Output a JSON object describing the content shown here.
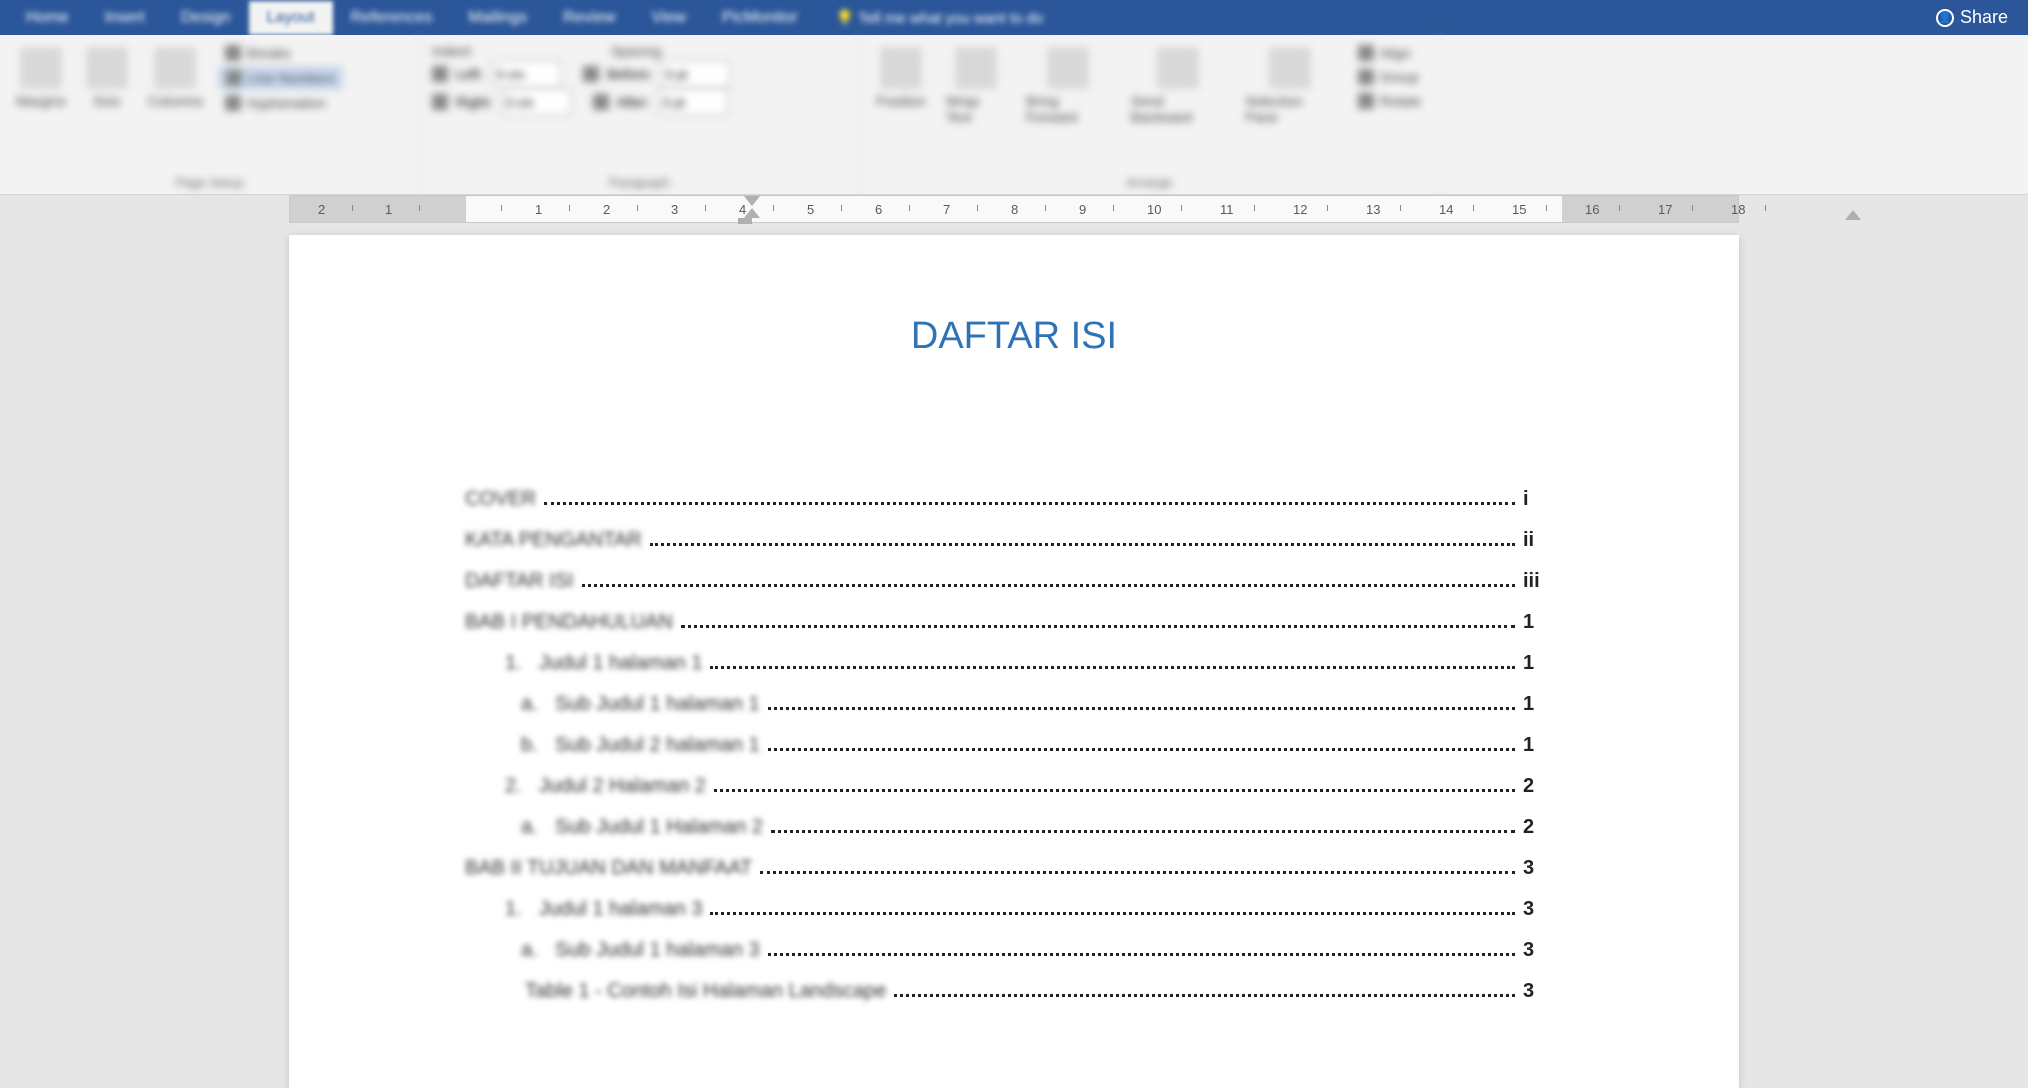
{
  "ribbon": {
    "tabs": [
      "Home",
      "Insert",
      "Design",
      "Layout",
      "References",
      "Mailings",
      "Review",
      "View",
      "PicMonitor"
    ],
    "active_tab": "Layout",
    "tell_me": "Tell me what you want to do",
    "share": "Share",
    "groups": {
      "page_setup": {
        "label": "Page Setup",
        "margins": "Margins",
        "size": "Size",
        "columns": "Columns",
        "breaks": "Breaks",
        "line_numbers": "Line Numbers",
        "hyphenation": "Hyphenation"
      },
      "indent": {
        "label": "Indent",
        "left_label": "Left:",
        "left_value": "0 cm",
        "right_label": "Right:",
        "right_value": "0 cm"
      },
      "spacing": {
        "label": "Spacing",
        "before_label": "Before:",
        "before_value": "0 pt",
        "after_label": "After:",
        "after_value": "0 pt"
      },
      "paragraph": {
        "label": "Paragraph"
      },
      "arrange": {
        "label": "Arrange",
        "position": "Position",
        "wrap": "Wrap Text",
        "bring": "Bring Forward",
        "send": "Send Backward",
        "selection": "Selection Pane",
        "align": "Align",
        "group": "Group",
        "rotate": "Rotate"
      }
    }
  },
  "ruler": {
    "marks": [
      2,
      1,
      1,
      2,
      3,
      4,
      5,
      6,
      7,
      8,
      9,
      10,
      11,
      12,
      13,
      14,
      15,
      16,
      17,
      18
    ]
  },
  "document": {
    "title": "DAFTAR ISI",
    "toc": [
      {
        "label": "COVER",
        "page": "i",
        "indent": 0
      },
      {
        "label": "KATA PENGANTAR",
        "page": "ii",
        "indent": 0
      },
      {
        "label": "DAFTAR ISI",
        "page": "iii",
        "indent": 0
      },
      {
        "label": "BAB I PENDAHULUAN",
        "page": "1",
        "indent": 0
      },
      {
        "bullet": "1.",
        "label": "Judul 1 halaman 1",
        "page": "1",
        "indent": 1
      },
      {
        "bullet": "a.",
        "label": "Sub Judul 1 halaman 1",
        "page": "1",
        "indent": 2
      },
      {
        "bullet": "b.",
        "label": "Sub Judul 2 halaman 1",
        "page": "1",
        "indent": 2
      },
      {
        "bullet": "2.",
        "label": "Judul 2 Halaman 2",
        "page": "2",
        "indent": 1
      },
      {
        "bullet": "a.",
        "label": "Sub Judul 1 Halaman 2",
        "page": "2",
        "indent": 2
      },
      {
        "label": "BAB II TUJUAN DAN MANFAAT",
        "page": "3",
        "indent": 0
      },
      {
        "bullet": "1.",
        "label": "Judul 1 halaman 3",
        "page": "3",
        "indent": 1
      },
      {
        "bullet": "a.",
        "label": "Sub Judul 1 halaman 3",
        "page": "3",
        "indent": 2
      },
      {
        "label": "Table 1 - Contoh Isi Halaman Landscape",
        "page": "3",
        "indent": 3
      }
    ]
  }
}
